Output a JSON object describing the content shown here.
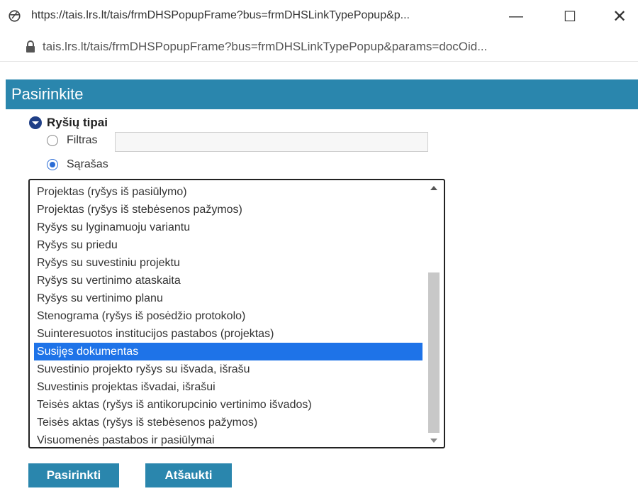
{
  "window": {
    "title": "https://tais.lrs.lt/tais/frmDHSPopupFrame?bus=frmDHSLinkTypePopup&p...",
    "url": "tais.lrs.lt/tais/frmDHSPopupFrame?bus=frmDHSLinkTypePopup&params=docOid...",
    "controls": {
      "minimize": "—",
      "maximize": "☐",
      "close": "✕"
    }
  },
  "header": {
    "title": "Pasirinkite"
  },
  "group": {
    "label": "Ryšių tipai",
    "filter_label": "Filtras",
    "filter_value": "",
    "list_label": "Sąrašas",
    "selected_mode": "list"
  },
  "list": {
    "items": [
      "Projektas (ryšys iš pasiūlymo)",
      "Projektas (ryšys iš stebėsenos pažymos)",
      "Ryšys su lyginamuoju variantu",
      "Ryšys su priedu",
      "Ryšys su suvestiniu projektu",
      "Ryšys su vertinimo ataskaita",
      "Ryšys su vertinimo planu",
      "Stenograma (ryšys iš posėdžio protokolo)",
      "Suinteresuotos institucijos pastabos (projektas)",
      "Susijęs dokumentas",
      "Suvestinio projekto ryšys su išvada, išrašu",
      "Suvestinis projektas išvadai, išrašui",
      "Teisės aktas (ryšys iš antikorupcinio vertinimo išvados)",
      "Teisės aktas (ryšys iš stebėsenos pažymos)",
      "Visuomenės pastabos ir pasiūlymai"
    ],
    "selected_index": 9
  },
  "buttons": {
    "ok": "Pasirinkti",
    "cancel": "Atšaukti"
  },
  "colors": {
    "accent": "#2a86ad",
    "selection": "#1e73e8"
  }
}
